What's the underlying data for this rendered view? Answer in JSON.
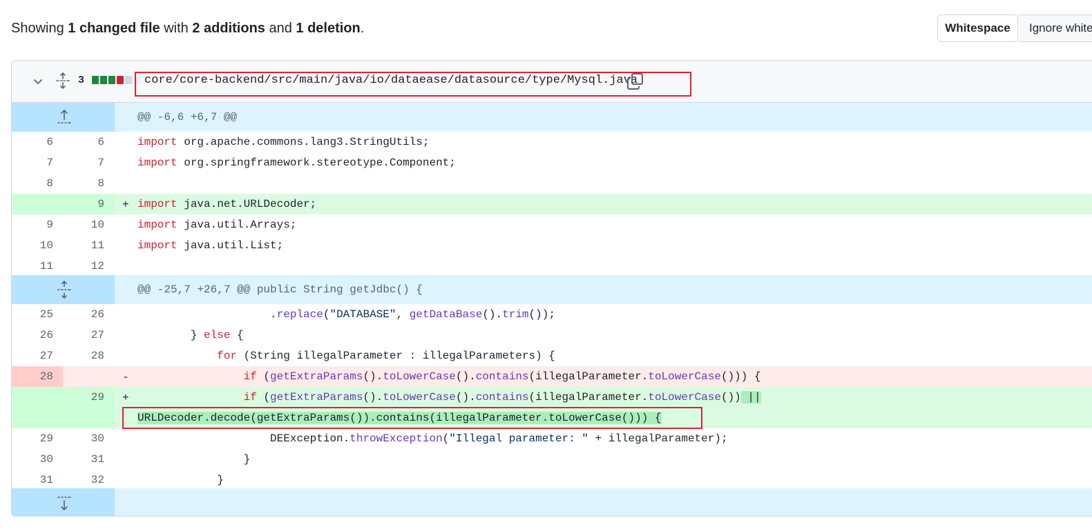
{
  "summary": {
    "prefix": "Showing ",
    "changed": "1 changed file",
    "with": " with ",
    "additions": "2 additions",
    "and": " and ",
    "deletions": "1 deletion",
    "suffix": "."
  },
  "toolbar": {
    "whitespace_label": "Whitespace",
    "ignore_label": "Ignore whitespace"
  },
  "file": {
    "change_count": "3",
    "path": "core/core-backend/src/main/java/io/dataease/datasource/type/Mysql.java",
    "diffstat_blocks": [
      "add",
      "add",
      "add",
      "del",
      "neutral",
      "neutral"
    ],
    "icons": {
      "collapse": "chevron-down-icon",
      "expand_all": "unfold-icon",
      "copy": "copy-icon",
      "expand_up": "expand-up-icon",
      "expand_both": "unfold-icon",
      "expand_down": "expand-down-icon"
    }
  },
  "colors": {
    "addition_bg": "#dafbe1",
    "addition_gutter": "#ccffd8",
    "deletion_bg": "#ffebe9",
    "deletion_gutter": "#ffcecb",
    "hunk_bg": "#ddf4ff",
    "highlight_red": "#e5202a"
  },
  "hunks": [
    "@@ -6,6 +6,7 @@",
    "@@ -25,7 +26,7 @@ public String getJdbc() {"
  ],
  "lines": {
    "l1": {
      "old": "6",
      "new": "6"
    },
    "l2": {
      "old": "7",
      "new": "7"
    },
    "l3": {
      "old": "8",
      "new": "8"
    },
    "l4": {
      "old": "",
      "new": "9",
      "sign": "+"
    },
    "l5": {
      "old": "9",
      "new": "10"
    },
    "l6": {
      "old": "10",
      "new": "11"
    },
    "l7": {
      "old": "11",
      "new": "12"
    },
    "l8": {
      "old": "25",
      "new": "26"
    },
    "l9": {
      "old": "26",
      "new": "27"
    },
    "l10": {
      "old": "27",
      "new": "28"
    },
    "l11": {
      "old": "28",
      "new": "",
      "sign": "-"
    },
    "l12": {
      "old": "",
      "new": "29",
      "sign": "+"
    },
    "l13": {
      "old": "29",
      "new": "30"
    },
    "l14": {
      "old": "30",
      "new": "31"
    },
    "l15": {
      "old": "31",
      "new": "32"
    }
  },
  "tokens": {
    "import": "import",
    "pkg1": " org.apache.commons.lang3.StringUtils;",
    "pkg2": " org.springframework.stereotype.Component;",
    "pkg3": " java.net.URLDecoder;",
    "pkg4": " java.util.Arrays;",
    "pkg5": " java.util.List;",
    "l8_indent": "                    .",
    "replace": "replace",
    "l8_open": "(",
    "db_str": "\"DATABASE\"",
    "comma": ", ",
    "getDataBase": "getDataBase",
    "call_dot": "().",
    "trim": "trim",
    "l8_end": "());",
    "l9_indent": "        } ",
    "else": "else",
    "l9_end": " {",
    "l10_indent": "            ",
    "for": "for",
    "l10_rest": " (String illegalParameter : illegalParameters) {",
    "if_indent": "                ",
    "if": "if",
    "paren_open": " (",
    "getExtraParams": "getExtraParams",
    "toLowerCase": "toLowerCase",
    "contains": "contains",
    "contains_arg": "(illegalParameter.",
    "del_end": "())) {",
    "add_mid": "())",
    "or_op": " ||",
    "wrap_line": "URLDecoder.decode(getExtraParams()).contains(illegalParameter.toLowerCase())) {",
    "l13_indent": "                    DEException.",
    "throwException": "throwException",
    "l13_open": "(",
    "ill_str": "\"Illegal parameter: \"",
    "l13_end": " + illegalParameter);",
    "l14_code": "                }",
    "l15_code": "            }"
  }
}
